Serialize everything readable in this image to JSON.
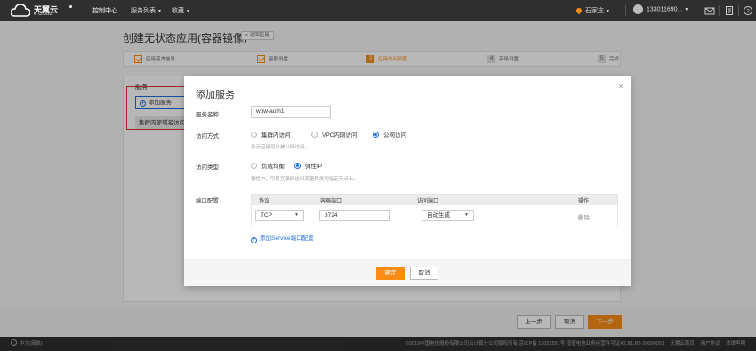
{
  "topnav": {
    "logo_cn": "天翼云",
    "logo_en": "e Cloud",
    "console": "控制中心",
    "services": "服务列表",
    "favorites": "收藏",
    "region": "石家庄",
    "user": "133011690...",
    "colors": {
      "bar": "#2f2f2f",
      "accent": "#fa8c16"
    }
  },
  "page": {
    "title": "创建无状态应用(容器镜像)",
    "back": "< 返回应用"
  },
  "steps": [
    {
      "label": "应用基本信息",
      "state": "done"
    },
    {
      "label": "容器设置",
      "state": "done"
    },
    {
      "num": "3",
      "label": "应用访问设置",
      "state": "current"
    },
    {
      "num": "4",
      "label": "高级设置",
      "state": "todo"
    },
    {
      "num": "5",
      "label": "完成",
      "state": "todo"
    }
  ],
  "background": {
    "section_label": "服务",
    "add_service": "添加服务",
    "table_header": "集群内部域名访问"
  },
  "modal": {
    "title": "添加服务",
    "close": "×",
    "service_name_label": "服务名称",
    "service_name_value": "wow-auth1",
    "access_mode_label": "访问方式",
    "access_modes": [
      "集群内访问",
      "VPC内网访问",
      "公网访问"
    ],
    "access_mode_selected": "公网访问",
    "access_mode_hint": "表示应用可以被公网访问。",
    "access_type_label": "访问类型",
    "access_types": [
      "负载均衡",
      "弹性IP"
    ],
    "access_type_selected": "弹性IP",
    "access_type_hint": "弹性IP，可将互联网访问流量转发到指定节点上。",
    "port_config_label": "端口配置",
    "port_table": {
      "headers": [
        "协议",
        "容器端口",
        "访问端口",
        "操作"
      ],
      "protocol": "TCP",
      "container_port": "3724",
      "access_port": "自动生成",
      "delete": "删除"
    },
    "add_port": "添加Service端口配置",
    "ok": "确定",
    "cancel": "取消"
  },
  "bottom": {
    "prev": "上一步",
    "cancel": "取消",
    "next": "下一步"
  },
  "footer": {
    "lang": "中文(简体)",
    "copyright": "©2019中国电信股份有限公司云计算分公司版权所有  京ICP备 12022551号  增值电信业务经营许可证A2.B1.B2-20090001",
    "links": [
      "天翼云首页",
      "用户协议",
      "法律声明"
    ]
  }
}
